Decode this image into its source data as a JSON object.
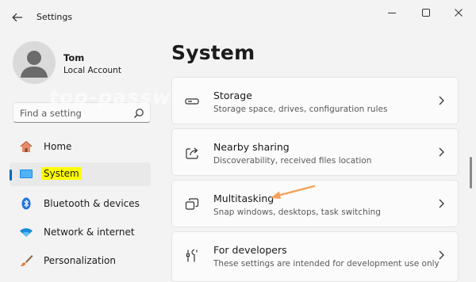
{
  "window": {
    "title": "Settings"
  },
  "profile": {
    "name": "Tom",
    "account_type": "Local Account"
  },
  "search": {
    "placeholder": "Find a setting"
  },
  "watermark": "top-password.com",
  "nav": {
    "items": [
      {
        "label": "Home",
        "icon": "home-icon"
      },
      {
        "label": "System",
        "icon": "display-icon",
        "selected": true
      },
      {
        "label": "Bluetooth & devices",
        "icon": "bluetooth-icon"
      },
      {
        "label": "Network & internet",
        "icon": "wifi-icon"
      },
      {
        "label": "Personalization",
        "icon": "brush-icon"
      }
    ]
  },
  "main": {
    "title": "System",
    "cards": [
      {
        "title": "Storage",
        "description": "Storage space, drives, configuration rules",
        "icon": "storage-drive-icon"
      },
      {
        "title": "Nearby sharing",
        "description": "Discoverability, received files location",
        "icon": "share-icon"
      },
      {
        "title": "Multitasking",
        "description": "Snap windows, desktops, task switching",
        "icon": "multitasking-icon"
      },
      {
        "title": "For developers",
        "description": "These settings are intended for development use only",
        "icon": "developer-tools-icon"
      }
    ]
  },
  "colors": {
    "accent": "#0067c0",
    "highlight": "#ffff00",
    "annotation_arrow": "#f5a15a"
  }
}
